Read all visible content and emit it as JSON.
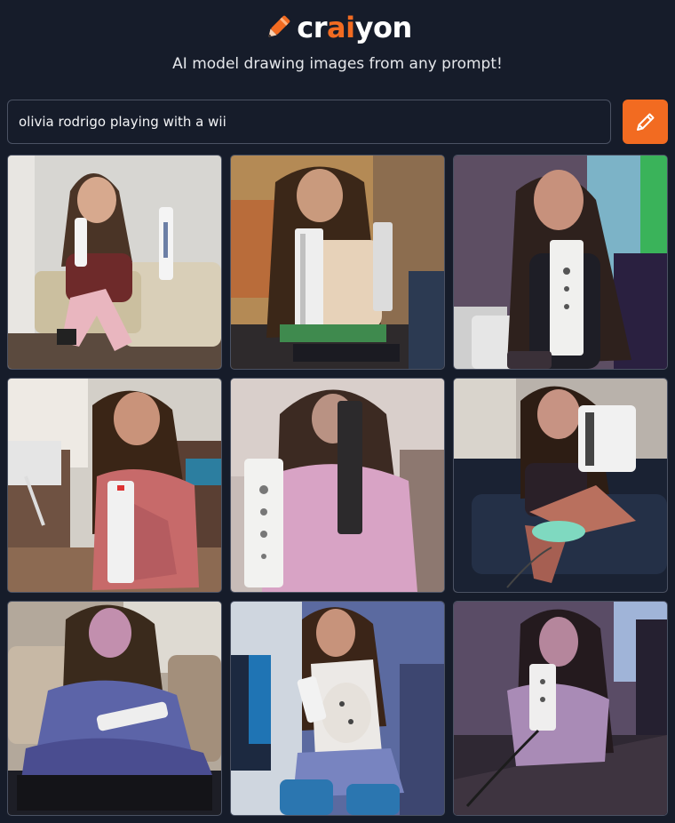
{
  "header": {
    "logo_prefix": "cr",
    "logo_accent": "ai",
    "logo_suffix": "yon",
    "tagline": "AI model drawing images from any prompt!"
  },
  "prompt": {
    "value": "olivia rodrigo playing with a wii",
    "button_icon": "pencil-icon"
  },
  "colors": {
    "background": "#161c2a",
    "accent": "#f26b21",
    "border": "#4b5263"
  },
  "images": [
    {
      "id": 1,
      "scene": "girl on couch holding two wii remotes"
    },
    {
      "id": 2,
      "scene": "girl with wii console and remote"
    },
    {
      "id": 3,
      "scene": "girl holding wii remote, green light"
    },
    {
      "id": 4,
      "scene": "girl in pink robe holding remote"
    },
    {
      "id": 5,
      "scene": "girl in pink sweater with remote"
    },
    {
      "id": 6,
      "scene": "girl on dark couch with console"
    },
    {
      "id": 7,
      "scene": "girl in blue outfit holding wii remote"
    },
    {
      "id": 8,
      "scene": "girl in white top with remote"
    },
    {
      "id": 9,
      "scene": "girl in dim room holding remote"
    }
  ]
}
